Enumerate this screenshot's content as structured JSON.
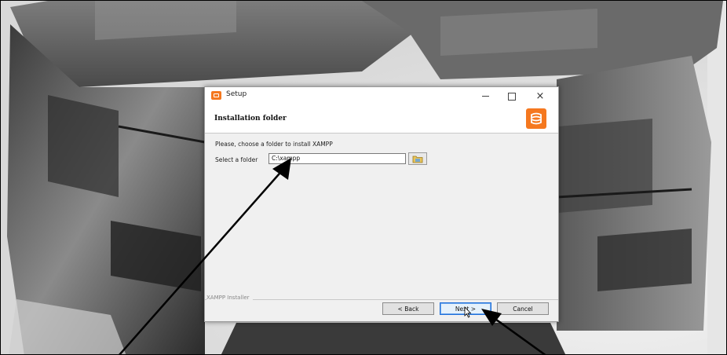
{
  "window": {
    "title": "Setup",
    "minimize_icon": "minimize-icon",
    "maximize_icon": "maximize-icon",
    "close_label": "×"
  },
  "header": {
    "title": "Installation folder",
    "logo": "xampp-logo-icon",
    "brand_color": "#f5781f"
  },
  "body": {
    "prompt": "Please, choose a folder to install XAMPP",
    "folder_label": "Select a folder",
    "folder_value": "C:\\xampp",
    "browse_icon": "folder-browse-icon"
  },
  "footer": {
    "group_label": "XAMPP Installer",
    "back_label": "< Back",
    "next_label": "Next >",
    "cancel_label": "Cancel"
  },
  "annotations": {
    "arrows": [
      "arrow-to-folder-input",
      "arrow-to-next-button"
    ],
    "color": "#000000"
  }
}
